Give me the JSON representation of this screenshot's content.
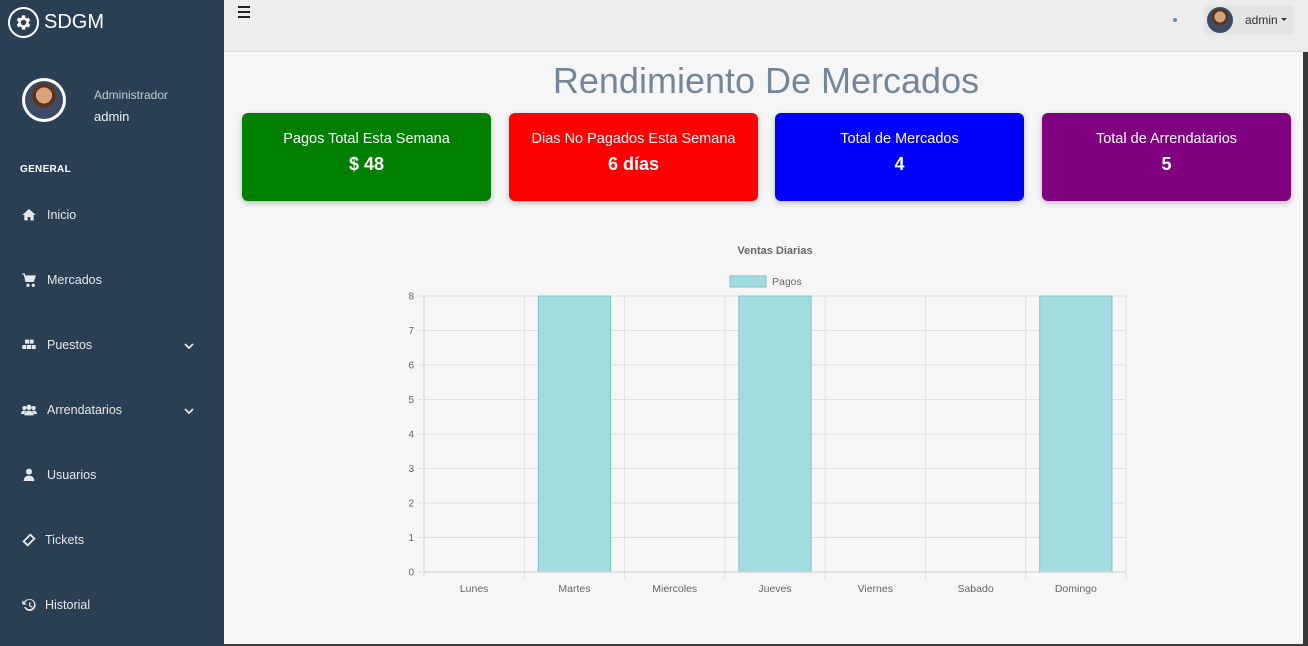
{
  "app": {
    "brand": "SDGM"
  },
  "profile": {
    "role": "Administrador",
    "name": "admin"
  },
  "sidebar": {
    "section_title": "GENERAL",
    "items": [
      {
        "label": "Inicio",
        "icon": "home-icon",
        "has_submenu": false
      },
      {
        "label": "Mercados",
        "icon": "cart-icon",
        "has_submenu": false
      },
      {
        "label": "Puestos",
        "icon": "cubes-icon",
        "has_submenu": true
      },
      {
        "label": "Arrendatarios",
        "icon": "users-icon",
        "has_submenu": true
      },
      {
        "label": "Usuarios",
        "icon": "user-icon",
        "has_submenu": false
      },
      {
        "label": "Tickets",
        "icon": "ticket-icon",
        "has_submenu": false
      },
      {
        "label": "Historial",
        "icon": "history-icon",
        "has_submenu": false
      }
    ]
  },
  "topbar": {
    "user_label": "admin"
  },
  "page": {
    "title": "Rendimiento De Mercados"
  },
  "cards": [
    {
      "label": "Pagos Total Esta Semana",
      "value": "$ 48",
      "color": "#008000"
    },
    {
      "label": "Dias No Pagados Esta Semana",
      "value": "6 días",
      "color": "#ff0000"
    },
    {
      "label": "Total de Mercados",
      "value": "4",
      "color": "#0000ff"
    },
    {
      "label": "Total de Arrendatarios",
      "value": "5",
      "color": "#800080"
    }
  ],
  "colors": {
    "sidebar_bg": "#2a3f54",
    "bar_fill": "#a3dcdf",
    "bar_border": "#77c6c9"
  },
  "chart_data": {
    "type": "bar",
    "title": "Ventas Diarias",
    "legend_position": "top",
    "categories": [
      "Lunes",
      "Martes",
      "Miercoles",
      "Jueves",
      "Viernes",
      "Sabado",
      "Domingo"
    ],
    "series": [
      {
        "name": "Pagos",
        "values": [
          0,
          8,
          0,
          8,
          0,
          0,
          8
        ]
      }
    ],
    "ylim": [
      0,
      8
    ],
    "yticks": [
      "0",
      "1",
      "2",
      "3",
      "4",
      "5",
      "6",
      "7",
      "8"
    ],
    "grid": true
  }
}
